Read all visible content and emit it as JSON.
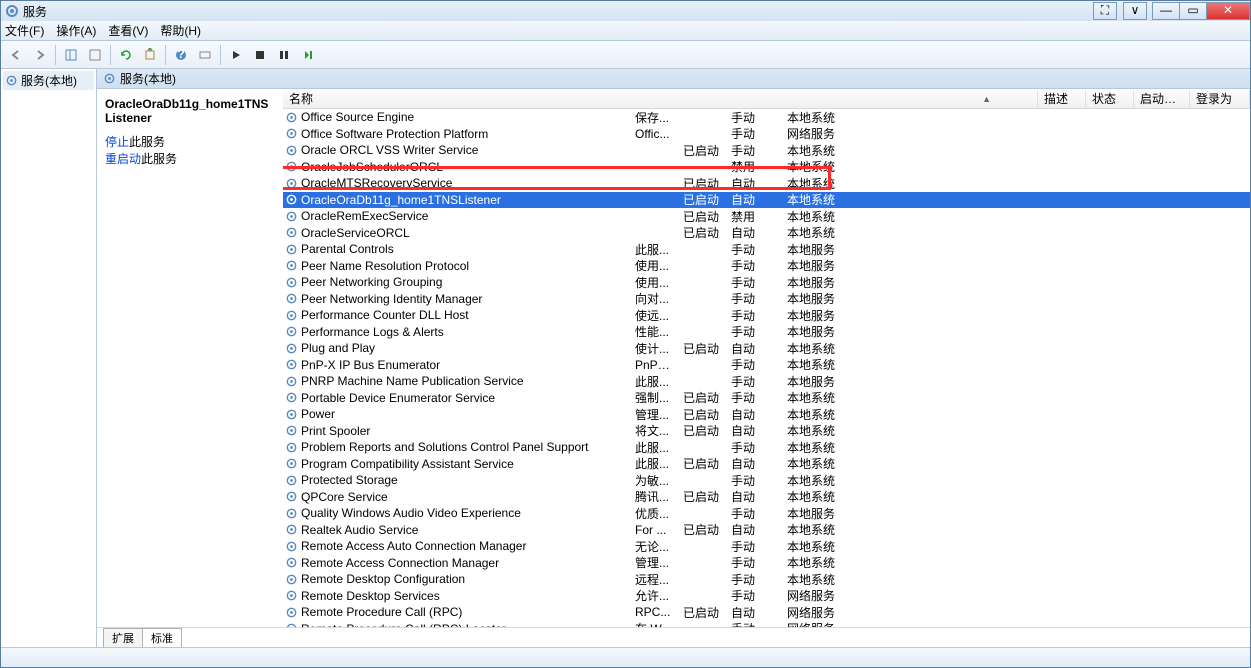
{
  "title": "服务",
  "menus": {
    "file": "文件(F)",
    "action": "操作(A)",
    "view": "查看(V)",
    "help": "帮助(H)"
  },
  "tree": {
    "root": "服务(本地)"
  },
  "detail_header": "服务(本地)",
  "info": {
    "selected": "OracleOraDb11g_home1TNSListener",
    "stop_label": "停止",
    "stop_suffix": "此服务",
    "restart_label": "重启动",
    "restart_suffix": "此服务"
  },
  "columns": {
    "name": "名称",
    "desc": "描述",
    "status": "状态",
    "startup": "启动类型",
    "logon": "登录为"
  },
  "tabs": {
    "extended": "扩展",
    "standard": "标准"
  },
  "services": [
    {
      "name": "Office  Source Engine",
      "desc": "保存...",
      "status": "",
      "startup": "手动",
      "logon": "本地系统"
    },
    {
      "name": "Office Software Protection Platform",
      "desc": "Offic...",
      "status": "",
      "startup": "手动",
      "logon": "网络服务"
    },
    {
      "name": "Oracle ORCL VSS Writer Service",
      "desc": "",
      "status": "已启动",
      "startup": "手动",
      "logon": "本地系统"
    },
    {
      "name": "OracleJobSchedulerORCL",
      "desc": "",
      "status": "",
      "startup": "禁用",
      "logon": "本地系统"
    },
    {
      "name": "OracleMTSRecoveryService",
      "desc": "",
      "status": "已启动",
      "startup": "自动",
      "logon": "本地系统"
    },
    {
      "name": "OracleOraDb11g_home1TNSListener",
      "desc": "",
      "status": "已启动",
      "startup": "自动",
      "logon": "本地系统",
      "selected": true
    },
    {
      "name": "OracleRemExecService",
      "desc": "",
      "status": "已启动",
      "startup": "禁用",
      "logon": "本地系统"
    },
    {
      "name": "OracleServiceORCL",
      "desc": "",
      "status": "已启动",
      "startup": "自动",
      "logon": "本地系统"
    },
    {
      "name": "Parental Controls",
      "desc": "此服...",
      "status": "",
      "startup": "手动",
      "logon": "本地服务"
    },
    {
      "name": "Peer Name Resolution Protocol",
      "desc": "使用...",
      "status": "",
      "startup": "手动",
      "logon": "本地服务"
    },
    {
      "name": "Peer Networking Grouping",
      "desc": "使用...",
      "status": "",
      "startup": "手动",
      "logon": "本地服务"
    },
    {
      "name": "Peer Networking Identity Manager",
      "desc": "向对...",
      "status": "",
      "startup": "手动",
      "logon": "本地服务"
    },
    {
      "name": "Performance Counter DLL Host",
      "desc": "使远...",
      "status": "",
      "startup": "手动",
      "logon": "本地服务"
    },
    {
      "name": "Performance Logs & Alerts",
      "desc": "性能...",
      "status": "",
      "startup": "手动",
      "logon": "本地服务"
    },
    {
      "name": "Plug and Play",
      "desc": "使计...",
      "status": "已启动",
      "startup": "自动",
      "logon": "本地系统"
    },
    {
      "name": "PnP-X IP Bus Enumerator",
      "desc": "PnP-...",
      "status": "",
      "startup": "手动",
      "logon": "本地系统"
    },
    {
      "name": "PNRP Machine Name Publication Service",
      "desc": "此服...",
      "status": "",
      "startup": "手动",
      "logon": "本地服务"
    },
    {
      "name": "Portable Device Enumerator Service",
      "desc": "强制...",
      "status": "已启动",
      "startup": "手动",
      "logon": "本地系统"
    },
    {
      "name": "Power",
      "desc": "管理...",
      "status": "已启动",
      "startup": "自动",
      "logon": "本地系统"
    },
    {
      "name": "Print Spooler",
      "desc": "将文...",
      "status": "已启动",
      "startup": "自动",
      "logon": "本地系统"
    },
    {
      "name": "Problem Reports and Solutions Control Panel Support",
      "desc": "此服...",
      "status": "",
      "startup": "手动",
      "logon": "本地系统"
    },
    {
      "name": "Program Compatibility Assistant Service",
      "desc": "此服...",
      "status": "已启动",
      "startup": "自动",
      "logon": "本地系统"
    },
    {
      "name": "Protected Storage",
      "desc": "为敏...",
      "status": "",
      "startup": "手动",
      "logon": "本地系统"
    },
    {
      "name": "QPCore Service",
      "desc": "腾讯...",
      "status": "已启动",
      "startup": "自动",
      "logon": "本地系统"
    },
    {
      "name": "Quality Windows Audio Video Experience",
      "desc": "优质...",
      "status": "",
      "startup": "手动",
      "logon": "本地服务"
    },
    {
      "name": "Realtek Audio Service",
      "desc": "For ...",
      "status": "已启动",
      "startup": "自动",
      "logon": "本地系统"
    },
    {
      "name": "Remote Access Auto Connection Manager",
      "desc": "无论...",
      "status": "",
      "startup": "手动",
      "logon": "本地系统"
    },
    {
      "name": "Remote Access Connection Manager",
      "desc": "管理...",
      "status": "",
      "startup": "手动",
      "logon": "本地系统"
    },
    {
      "name": "Remote Desktop Configuration",
      "desc": "远程...",
      "status": "",
      "startup": "手动",
      "logon": "本地系统"
    },
    {
      "name": "Remote Desktop Services",
      "desc": "允许...",
      "status": "",
      "startup": "手动",
      "logon": "网络服务"
    },
    {
      "name": "Remote Procedure Call (RPC)",
      "desc": "RPC...",
      "status": "已启动",
      "startup": "自动",
      "logon": "网络服务"
    },
    {
      "name": "Remote Procedure Call (RPC) Locator",
      "desc": "在 W...",
      "status": "",
      "startup": "手动",
      "logon": "网络服务"
    }
  ]
}
